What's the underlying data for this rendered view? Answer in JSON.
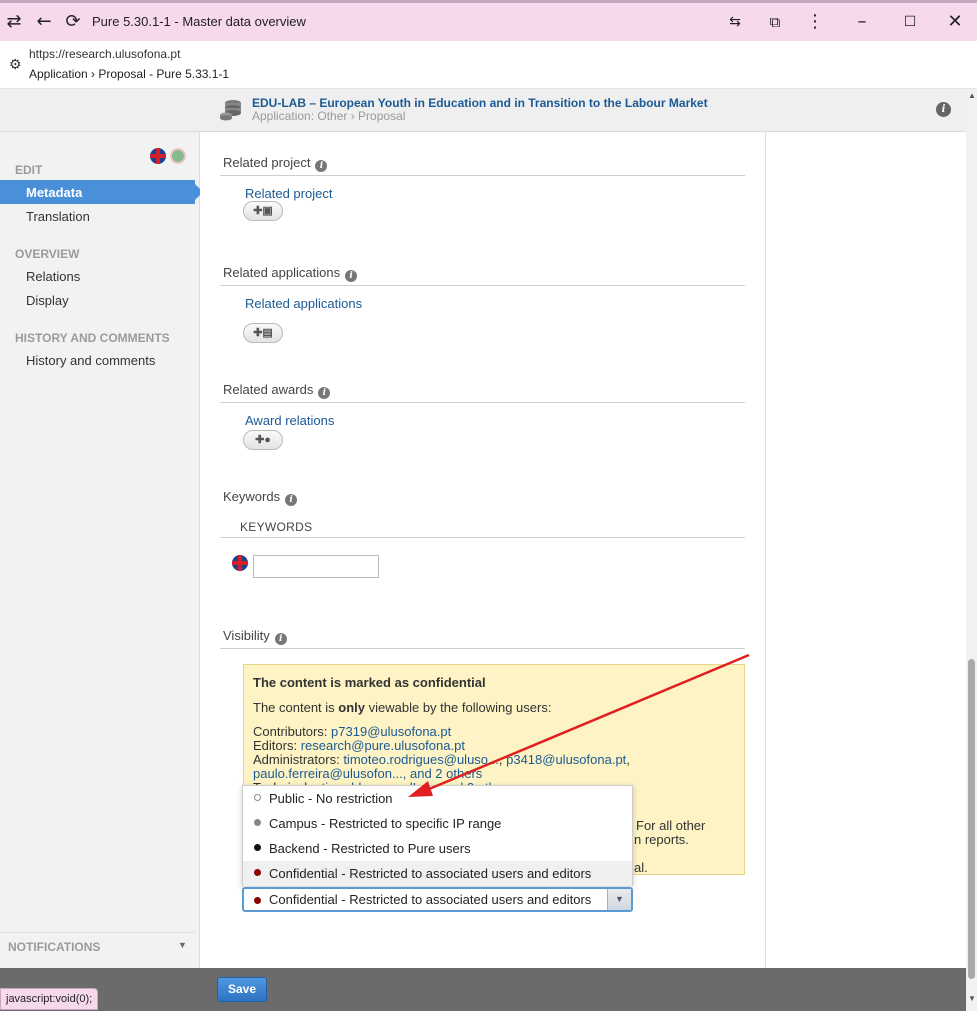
{
  "browser": {
    "title": "Pure 5.30.1-1 - Master data overview",
    "url": "https://research.ulusofona.pt",
    "breadcrumb": "Application › Proposal - Pure 5.33.1-1",
    "status_url": "javascript:void(0);"
  },
  "header": {
    "title": "EDU-LAB – European Youth in Education and in Transition to the Labour Market",
    "subtitle": "Application: Other › Proposal"
  },
  "sidebar": {
    "edit_heading": "EDIT",
    "metadata": "Metadata",
    "translation": "Translation",
    "overview_heading": "OVERVIEW",
    "relations": "Relations",
    "display": "Display",
    "history_heading": "HISTORY AND COMMENTS",
    "history_item": "History and comments",
    "notifications": "NOTIFICATIONS"
  },
  "sections": {
    "related_project": {
      "title": "Related project",
      "link": "Related project"
    },
    "related_applications": {
      "title": "Related applications",
      "link": "Related applications"
    },
    "related_awards": {
      "title": "Related awards",
      "link": "Award relations"
    },
    "keywords": {
      "title": "Keywords",
      "header": "KEYWORDS",
      "value": ""
    },
    "visibility": {
      "title": "Visibility"
    }
  },
  "visibility_box": {
    "title": "The content is marked as confidential",
    "line1_pre": "The content is ",
    "line1_bold": "only",
    "line1_post": " viewable by the following users:",
    "contributors_label": "Contributors: ",
    "contributors": "p7319@ulusofona.pt",
    "editors_label": "Editors: ",
    "editors": "research@pure.ulusofona.pt",
    "admins_label": "Administrators: ",
    "admins_1": "timoteo.rodrigues@uluso...",
    "admins_sep": ", ",
    "admins_2": "p3418@ulusofona.pt",
    "admins_3": "paulo.ferreira@ulusofon...",
    "admins_more": ", and 2 others",
    "technical_label": "Technical: ",
    "technical": "atira, ddp, recordLog, and 2 others",
    "right_1": "For all other",
    "right_2": "n reports.",
    "right_3": "al."
  },
  "dropdown": {
    "options": [
      {
        "label": "Public - No restriction",
        "color": "#ffffff"
      },
      {
        "label": "Campus - Restricted to specific IP range",
        "color": "#888888"
      },
      {
        "label": "Backend - Restricted to Pure users",
        "color": "#111111"
      },
      {
        "label": "Confidential - Restricted to associated users and editors",
        "color": "#8b0000"
      }
    ],
    "selected": "Confidential - Restricted to associated users and editors"
  },
  "footer": {
    "save": "Save"
  },
  "colors": {
    "accent": "#4a90d9",
    "link": "#1b5a94",
    "confidential": "#8b0000",
    "annotation_arrow": "#e02020"
  }
}
